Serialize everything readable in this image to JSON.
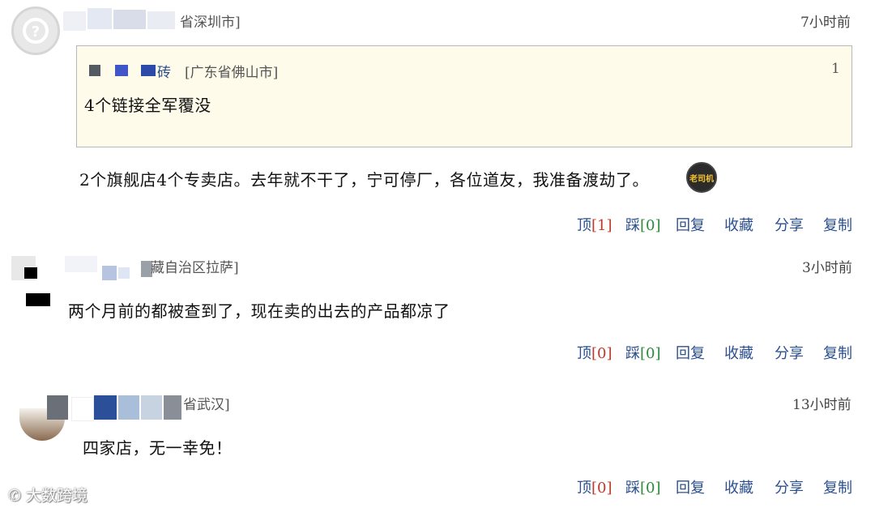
{
  "comments": [
    {
      "location": "省深圳市]",
      "time": "7小时前",
      "quote": {
        "user_fragment": "砖",
        "location": "[广东省佛山市]",
        "count": "1",
        "text": "4个链接全军覆没"
      },
      "text": "2个旗舰店4个专卖店。去年就不干了，宁可停厂，各位道友，我准备渡劫了。",
      "badge_label": "老司机",
      "actions": {
        "up": "顶",
        "up_count": "[1]",
        "down": "踩",
        "down_count": "[0]",
        "reply": "回复",
        "fav": "收藏",
        "share": "分享",
        "copy": "复制"
      }
    },
    {
      "location": "藏自治区拉萨]",
      "time": "3小时前",
      "text": "两个月前的都被查到了，现在卖的出去的产品都凉了",
      "actions": {
        "up": "顶",
        "up_count": "[0]",
        "down": "踩",
        "down_count": "[0]",
        "reply": "回复",
        "fav": "收藏",
        "share": "分享",
        "copy": "复制"
      }
    },
    {
      "location": "省武汉]",
      "time": "13小时前",
      "text": "四家店，无一幸免！",
      "actions": {
        "up": "顶",
        "up_count": "[0]",
        "down": "踩",
        "down_count": "[0]",
        "reply": "回复",
        "fav": "收藏",
        "share": "分享",
        "copy": "复制"
      }
    }
  ],
  "watermark": "大数跨境",
  "colors": {
    "link": "#2b4f8f",
    "up_count": "#c0392b",
    "down_count": "#2e8b3d",
    "quote_bg": "#fffbea"
  }
}
